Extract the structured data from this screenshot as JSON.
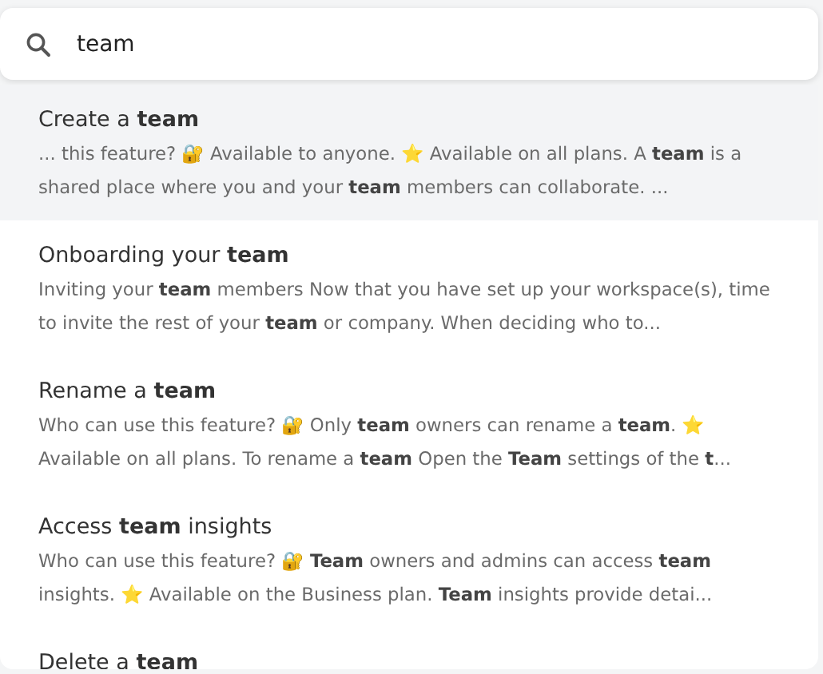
{
  "search": {
    "value": "team"
  },
  "results": [
    {
      "title": "Create a **team**",
      "snippet": "... this feature? 🔐 Available to anyone. ⭐ Available on all plans. A **team** is a shared place where you and your **team** members can collaborate. ...",
      "selected": true
    },
    {
      "title": "Onboarding your **team**",
      "snippet": "Inviting your **team** members Now that you have set up your workspace(s), time to invite the rest of your **team** or company. When deciding who to...",
      "selected": false
    },
    {
      "title": "Rename a **team**",
      "snippet": "Who can use this feature? 🔐 Only **team** owners can rename a **team**. ⭐ Available on all plans. To rename a **team** Open the **Team** settings of the **t**...",
      "selected": false
    },
    {
      "title": "Access **team** insights",
      "snippet": "Who can use this feature? 🔐 **Team** owners and admins can access **team** insights. ⭐ Available on the Business plan. **Team** insights provide detai...",
      "selected": false
    },
    {
      "title": "Delete a **team**",
      "selected": false
    }
  ]
}
